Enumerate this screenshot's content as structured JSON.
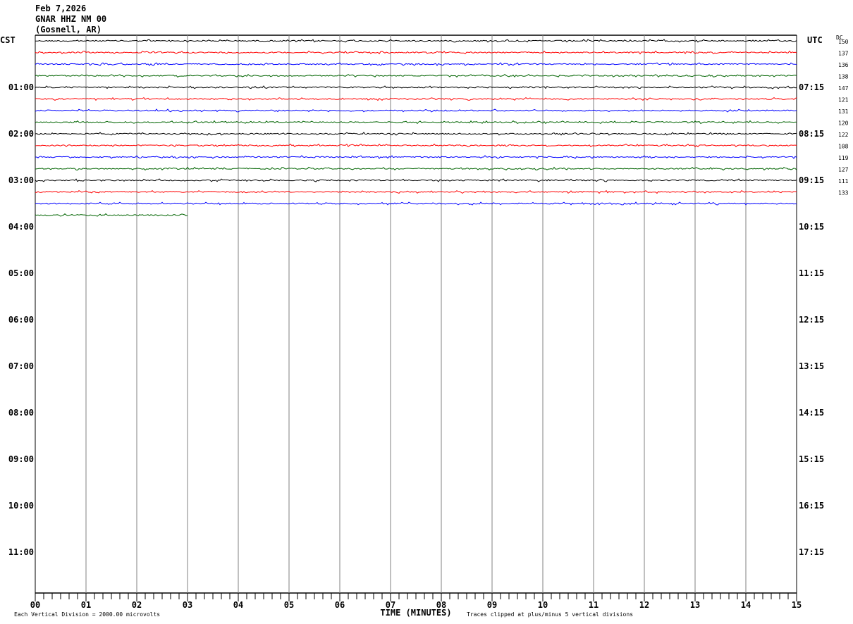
{
  "header": {
    "date": "Feb 7,2026",
    "station": "GNAR HHZ NM 00",
    "location": "(Gosnell, AR)"
  },
  "chart_data": {
    "type": "line",
    "title": "GNAR HHZ NM 00",
    "left_timezone": "CST",
    "right_timezone": "UTC",
    "dc_header": "DC",
    "left_hour_labels": [
      "01:00",
      "02:00",
      "03:00",
      "04:00",
      "05:00",
      "06:00",
      "07:00",
      "08:00",
      "09:00",
      "10:00",
      "11:00"
    ],
    "right_hour_labels": [
      "07:15",
      "08:15",
      "09:15",
      "10:15",
      "11:15",
      "12:15",
      "13:15",
      "14:15",
      "15:15",
      "16:15",
      "17:15"
    ],
    "x_tick_labels": [
      "00",
      "01",
      "02",
      "03",
      "04",
      "05",
      "06",
      "07",
      "08",
      "09",
      "10",
      "11",
      "12",
      "13",
      "14",
      "15"
    ],
    "xlabel": "TIME (MINUTES)",
    "xlim": [
      0,
      15
    ],
    "rows_per_hour": 4,
    "trace_colors": [
      "#000000",
      "#ff0000",
      "#0000ff",
      "#006400"
    ],
    "dc_offsets": [
      150,
      137,
      136,
      138,
      147,
      121,
      131,
      120,
      122,
      108,
      119,
      127,
      111,
      133
    ],
    "full_traces": 15,
    "last_trace_end_minute": 3,
    "grid": true,
    "footer_left": "Each Vertical Division = 2000.00 microvolts",
    "footer_right": "Traces clipped at plus/minus 5 vertical divisions"
  }
}
